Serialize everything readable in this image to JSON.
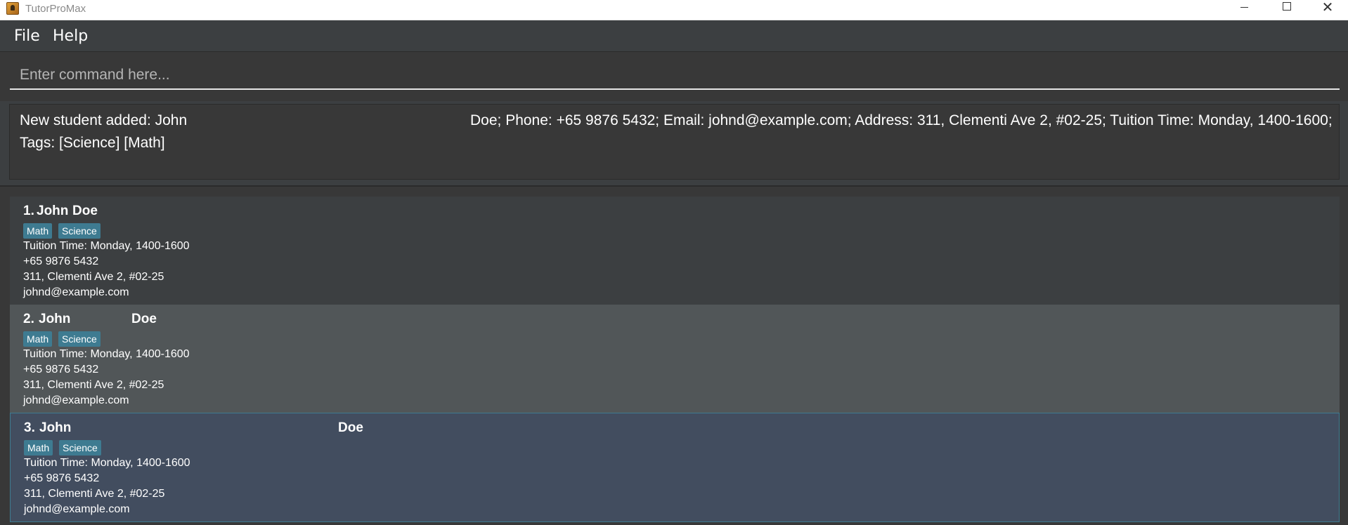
{
  "window": {
    "title": "TutorProMax"
  },
  "menu": {
    "file": "File",
    "help": "Help"
  },
  "command": {
    "placeholder": "Enter command here..."
  },
  "result": {
    "line1_part1": "New student added: John",
    "line1_part2": "Doe; Phone: +65 9876 5432; Email: johnd@example.com; Address: 311, Clementi Ave 2, #02-25; Tuition Time: Monday, 1400-1600;",
    "line2": "Tags: [Science] [Math]"
  },
  "students": [
    {
      "index": "1.",
      "first": "John",
      "last": "Doe",
      "tags": [
        "Math",
        "Science"
      ],
      "tuition_time": "Tuition Time: Monday, 1400-1600",
      "phone": "+65 9876 5432",
      "address": "311, Clementi Ave 2, #02-25",
      "email": "johnd@example.com"
    },
    {
      "index": "2.",
      "first": "John",
      "last": "Doe",
      "tags": [
        "Math",
        "Science"
      ],
      "tuition_time": "Tuition Time: Monday, 1400-1600",
      "phone": "+65 9876 5432",
      "address": "311, Clementi Ave 2, #02-25",
      "email": "johnd@example.com"
    },
    {
      "index": "3.",
      "first": "John",
      "last": "Doe",
      "tags": [
        "Math",
        "Science"
      ],
      "tuition_time": "Tuition Time: Monday, 1400-1600",
      "phone": "+65 9876 5432",
      "address": "311, Clementi Ave 2, #02-25",
      "email": "johnd@example.com"
    }
  ],
  "colors": {
    "background": "#3c3f41",
    "selected_card": "#424d5f",
    "hover_card": "#515658",
    "tag": "#3e7b91"
  }
}
